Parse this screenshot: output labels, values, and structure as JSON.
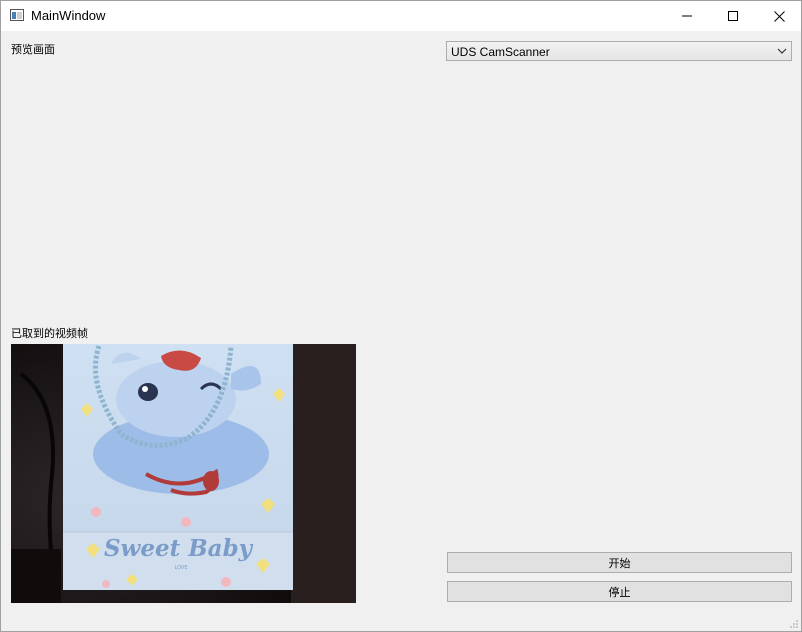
{
  "window": {
    "title": "MainWindow"
  },
  "preview": {
    "label": "预览画面"
  },
  "camera_select": {
    "selected": "UDS CamScanner"
  },
  "captured": {
    "label": "已取到的视频帧",
    "image_text": {
      "brand": "Sweet Baby",
      "small": "LOVE"
    }
  },
  "buttons": {
    "start": "开始",
    "stop": "停止"
  },
  "icons": {
    "minimize": "minimize-icon",
    "maximize": "maximize-icon",
    "close": "close-icon",
    "dropdown": "chevron-down-icon"
  }
}
